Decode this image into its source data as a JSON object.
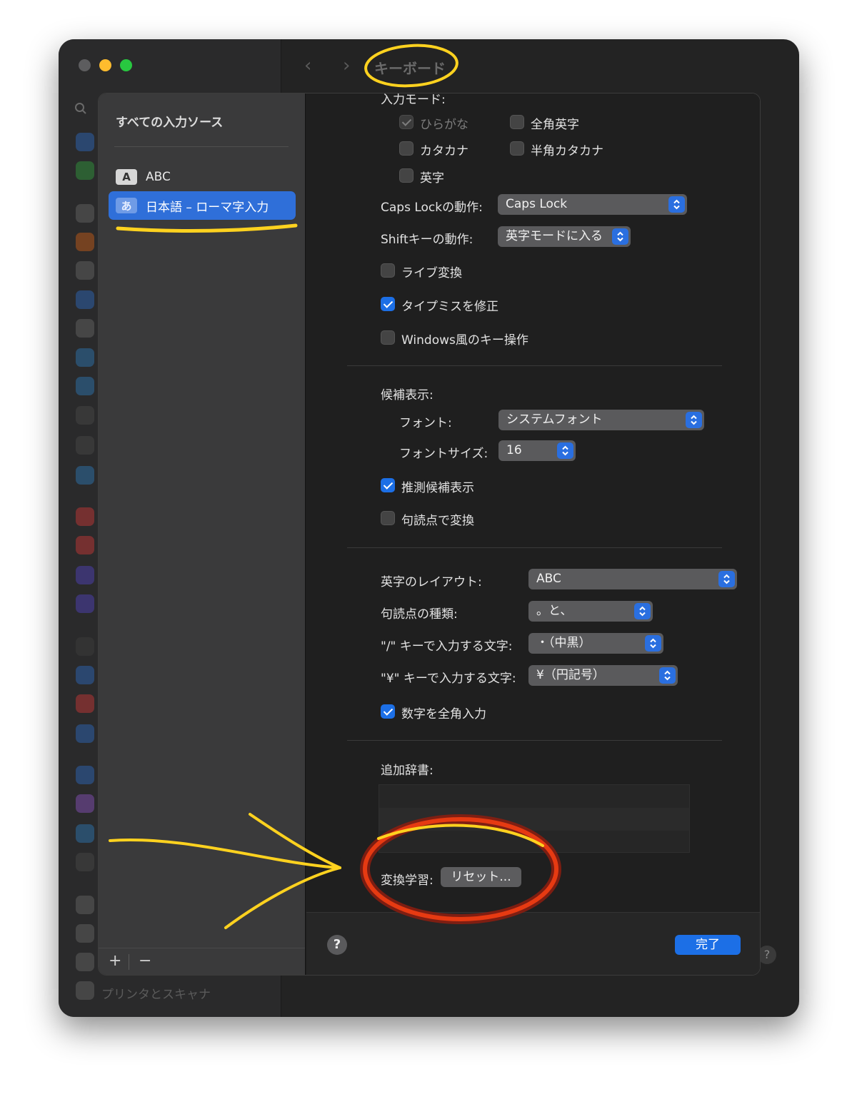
{
  "window": {
    "title": "キーボード",
    "sidebar_bottom_label": "プリンタとスキャナ",
    "nav_back": "‹",
    "nav_forward": "›",
    "help": "?"
  },
  "sources": {
    "heading": "すべての入力ソース",
    "items": [
      {
        "badge": "A",
        "label": "ABC"
      },
      {
        "badge": "あ",
        "label": "日本語 – ローマ字入力"
      }
    ],
    "add_label": "+",
    "remove_label": "−"
  },
  "settings": {
    "input_modes_label": "入力モード:",
    "modes": {
      "hiragana": "ひらがな",
      "zenkaku_eiji": "全角英字",
      "katakana": "カタカナ",
      "hankaku_katakana": "半角カタカナ",
      "eiji": "英字"
    },
    "caps_lock_label": "Caps Lockの動作:",
    "caps_lock_value": "Caps Lock",
    "shift_label": "Shiftキーの動作:",
    "shift_value": "英字モードに入る",
    "live_conversion": "ライブ変換",
    "typo_correction": "タイプミスを修正",
    "windows_keys": "Windows風のキー操作",
    "candidates_label": "候補表示:",
    "font_label": "フォント:",
    "font_value": "システムフォント",
    "font_size_label": "フォントサイズ:",
    "font_size_value": "16",
    "predictive": "推測候補表示",
    "punct_convert": "句読点で変換",
    "layout_label": "英字のレイアウト:",
    "layout_value": "ABC",
    "punct_type_label": "句読点の種類:",
    "punct_type_value": "。と、",
    "slash_label": "\"/\" キーで入力する文字:",
    "slash_value": "・（中黒）",
    "yen_label": "\"¥\" キーで入力する文字:",
    "yen_value": "¥（円記号）",
    "fullwidth_numbers": "数字を全角入力",
    "dictionaries_label": "追加辞書:",
    "learning_label": "変換学習:",
    "reset_button": "リセット...",
    "help_button": "?",
    "done_button": "完了"
  },
  "colors": {
    "accent": "#1c6fe6",
    "annotation_yellow": "#ffd21f",
    "annotation_red": "#d9200c"
  }
}
